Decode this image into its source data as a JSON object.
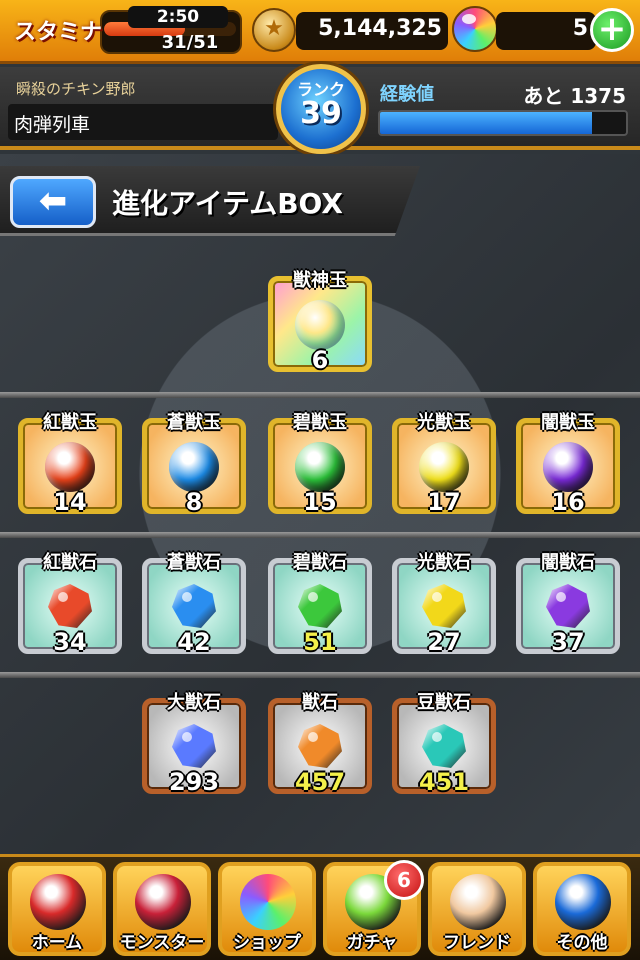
{
  "status_bar": {
    "stamina_label": "スタミナ",
    "stamina_timer": "2:50",
    "stamina_count": "31/51",
    "stamina_fraction": 0.61,
    "gold": "5,144,325",
    "orbs": "5",
    "plus_label": "+"
  },
  "player": {
    "title": "瞬殺のチキン野郎",
    "name": "肉弾列車",
    "rank_label": "ランク",
    "rank": "39",
    "exp_label": "経験値",
    "exp_remaining": "あと 1375",
    "exp_fraction": 0.86
  },
  "page": {
    "back_label": "⬅",
    "title": "進化アイテムBOX"
  },
  "items": {
    "top": {
      "name": "獣神玉",
      "count": "6"
    },
    "orbs": [
      {
        "name": "紅獣玉",
        "count": "14",
        "color": "#e8421a"
      },
      {
        "name": "蒼獣玉",
        "count": "8",
        "color": "#1c8ce8"
      },
      {
        "name": "碧獣玉",
        "count": "15",
        "color": "#2cc23a"
      },
      {
        "name": "光獣玉",
        "count": "17",
        "color": "#f2e21a"
      },
      {
        "name": "闇獣玉",
        "count": "16",
        "color": "#7a2ad8"
      }
    ],
    "stones": [
      {
        "name": "紅獣石",
        "count": "34",
        "color": "#e84a2a"
      },
      {
        "name": "蒼獣石",
        "count": "42",
        "color": "#2a8ef0"
      },
      {
        "name": "碧獣石",
        "count": "51",
        "color": "#3cc83c"
      },
      {
        "name": "光獣石",
        "count": "27",
        "color": "#f2d81a"
      },
      {
        "name": "闇獣石",
        "count": "37",
        "color": "#8a3ae0"
      }
    ],
    "large": [
      {
        "name": "大獣石",
        "count": "293",
        "color": "#5a7aff"
      },
      {
        "name": "獣石",
        "count": "457",
        "color": "#f08a2a"
      },
      {
        "name": "豆獣石",
        "count": "451",
        "color": "#2ac8b8"
      }
    ]
  },
  "nav": {
    "items": [
      {
        "label": "ホーム",
        "icon": "home-icon",
        "color": "#d82a2a"
      },
      {
        "label": "モンスター",
        "icon": "monster-icon",
        "color": "#c82038"
      },
      {
        "label": "ショップ",
        "icon": "shop-orb-icon",
        "color": "#9a5cff"
      },
      {
        "label": "ガチャ",
        "icon": "gacha-egg-icon",
        "color": "#7ad83a"
      },
      {
        "label": "フレンド",
        "icon": "handshake-icon",
        "color": "#f0c8a0"
      },
      {
        "label": "その他",
        "icon": "radar-icon",
        "color": "#1a6ad8"
      }
    ],
    "gacha_badge": "6"
  }
}
